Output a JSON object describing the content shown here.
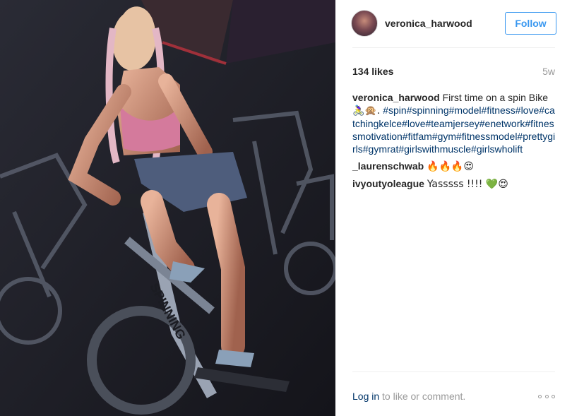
{
  "post": {
    "username": "veronica_harwood",
    "follow_label": "Follow",
    "likes": "134 likes",
    "age": "5w",
    "caption_text": "First time on a spin Bike",
    "caption_emoji": "🚴‍♀️🙊.",
    "caption_tags": "#spin#spinning#model#fitness#love#catchingkelce#love#teamjersey#enetwork#fitnessmotivation#fitfam#gym#fitnessmodel#prettygirls#gymrat#girlswithmuscle#girlswholift",
    "photo_label": "SPINNING"
  },
  "comments": [
    {
      "user": "_laurenschwab",
      "text": "🔥🔥🔥😍"
    },
    {
      "user": "ivyoutyoleague",
      "text": "Yasssss !!!! 💚😍"
    }
  ],
  "footer": {
    "login_label": "Log in",
    "rest_text": " to like or comment."
  },
  "colors": {
    "link": "#003569",
    "follow_accent": "#3897f0",
    "photo_top": "#pink"
  }
}
